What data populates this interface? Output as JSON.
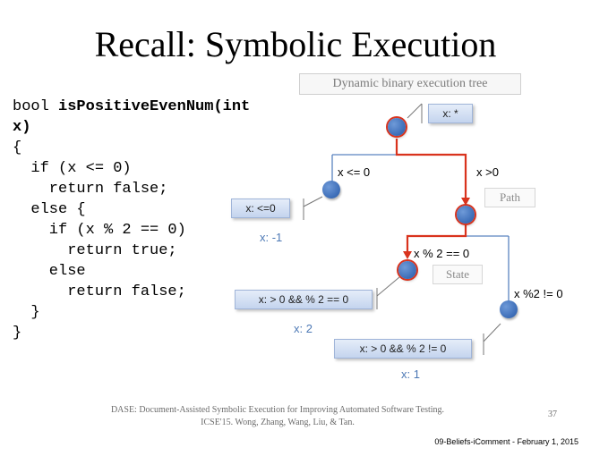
{
  "slide": {
    "title": "Recall: Symbolic Execution",
    "code_lines": [
      {
        "pre": "bool ",
        "bold": "isPositiveEvenNum(int",
        "post": ""
      },
      {
        "pre": "",
        "bold": "x)",
        "post": ""
      },
      {
        "pre": "{",
        "bold": "",
        "post": ""
      },
      {
        "pre": "  if (x <= 0)",
        "bold": "",
        "post": ""
      },
      {
        "pre": "    return false;",
        "bold": "",
        "post": ""
      },
      {
        "pre": "  else {",
        "bold": "",
        "post": ""
      },
      {
        "pre": "    if (x % 2 == 0)",
        "bold": "",
        "post": ""
      },
      {
        "pre": "      return true;",
        "bold": "",
        "post": ""
      },
      {
        "pre": "    else",
        "bold": "",
        "post": ""
      },
      {
        "pre": "      return false;",
        "bold": "",
        "post": ""
      },
      {
        "pre": "  }",
        "bold": "",
        "post": ""
      },
      {
        "pre": "}",
        "bold": "",
        "post": ""
      }
    ],
    "tree": {
      "label": "Dynamic binary execution tree",
      "root_state": "x: *",
      "left_condition": "x <= 0",
      "right_condition": "x >0",
      "left_state": "x: <=0",
      "left_value": "x: -1",
      "path_label": "Path",
      "even_condition": "x % 2 == 0",
      "odd_condition": "x %2 != 0",
      "state_label": "State",
      "even_state": "x: > 0 && % 2 == 0",
      "even_value": "x: 2",
      "odd_state": "x: > 0 && % 2 != 0",
      "odd_value": "x: 1"
    },
    "citation_line1": "DASE: Document-Assisted Symbolic Execution for Improving Automated Software Testing.",
    "citation_line2": "ICSE'15. Wong, Zhang, Wang, Liu, & Tan.",
    "page_number": "37",
    "footer": "09-Beliefs-iComment - February 1, 2015",
    "colors": {
      "highlight": "#d9331d",
      "edge": "#5a84c0",
      "node": "#3e6fb9"
    }
  }
}
